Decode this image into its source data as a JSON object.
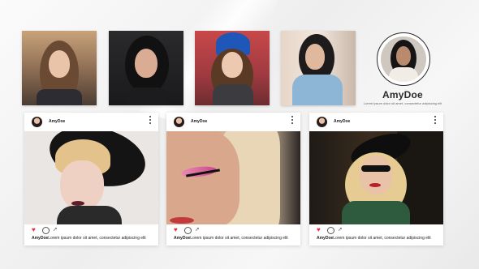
{
  "gallery": {
    "thumbnails": [
      {
        "subject": "woman-sunset-portrait"
      },
      {
        "subject": "woman-dark-hair-portrait"
      },
      {
        "subject": "woman-blue-beanie-portrait"
      },
      {
        "subject": "woman-denim-jacket-portrait"
      }
    ]
  },
  "profile": {
    "name": "AmyDoe",
    "subtitle": "Lorem ipsum dolor sit amet, consectetur adipiscing elit"
  },
  "posts": [
    {
      "username": "AmyDoe",
      "caption_user": "AmyDoe",
      "caption_text": "Lorem ipsum dolor sit amet, consectetur adipiscing elit",
      "image": "woman-black-hat-blonde"
    },
    {
      "username": "AmyDoe",
      "caption_user": "AmyDoe",
      "caption_text": "Lorem ipsum dolor sit amet, consectetur adipiscing elit",
      "image": "woman-pink-eyeliner-closeup"
    },
    {
      "username": "AmyDoe",
      "caption_user": "AmyDoe",
      "caption_text": "Lorem ipsum dolor sit amet, consectetur adipiscing elit",
      "image": "woman-black-hat-sunglasses"
    }
  ],
  "icons": {
    "like": "heart-icon",
    "comment": "comment-icon",
    "share": "share-icon",
    "more": "more-vertical-icon"
  },
  "colors": {
    "like": "#e0303a",
    "text": "#222222"
  }
}
